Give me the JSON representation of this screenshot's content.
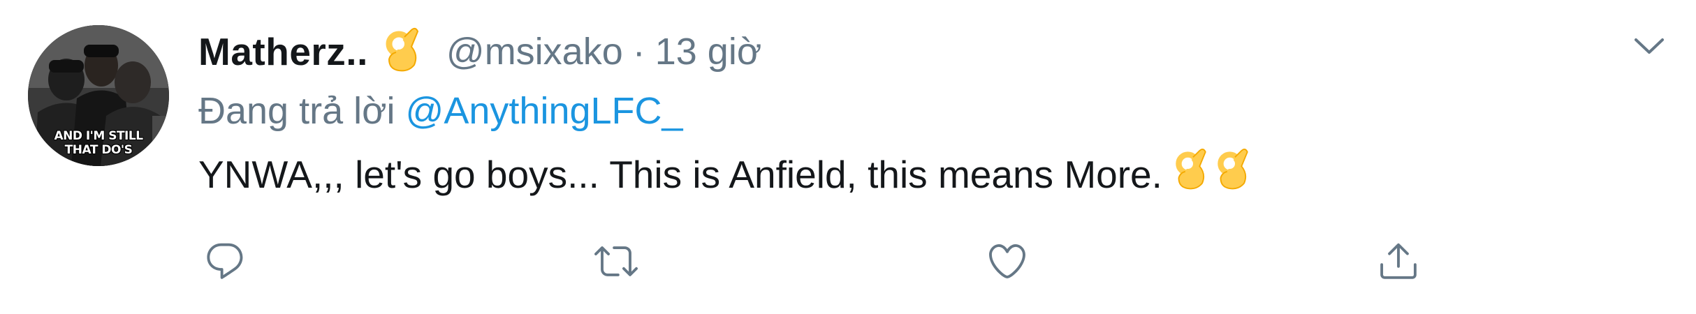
{
  "tweet": {
    "display_name": "Matherz..",
    "handle": "@msixako",
    "separator": "·",
    "time": "13 giờ",
    "replying_prefix": "Đang trả lời",
    "replying_to": "@AnythingLFC_",
    "text": "YNWA,,, let's go boys... This is Anfield, this means More.",
    "avatar_caption_line1": "AND I'M STILL",
    "avatar_caption_line2": "THAT DO'S"
  },
  "icons": {
    "name_emoji": "ok-hand-emoji",
    "text_emojis": [
      "ok-hand-emoji",
      "ok-hand-emoji"
    ],
    "menu": "chevron-down-icon",
    "actions": [
      "reply-icon",
      "retweet-icon",
      "like-icon",
      "share-icon"
    ]
  },
  "colors": {
    "primary_text": "#14171a",
    "secondary_text": "#657786",
    "link": "#1b95e0",
    "icon": "#657786",
    "emoji": "#ffcc4d"
  }
}
